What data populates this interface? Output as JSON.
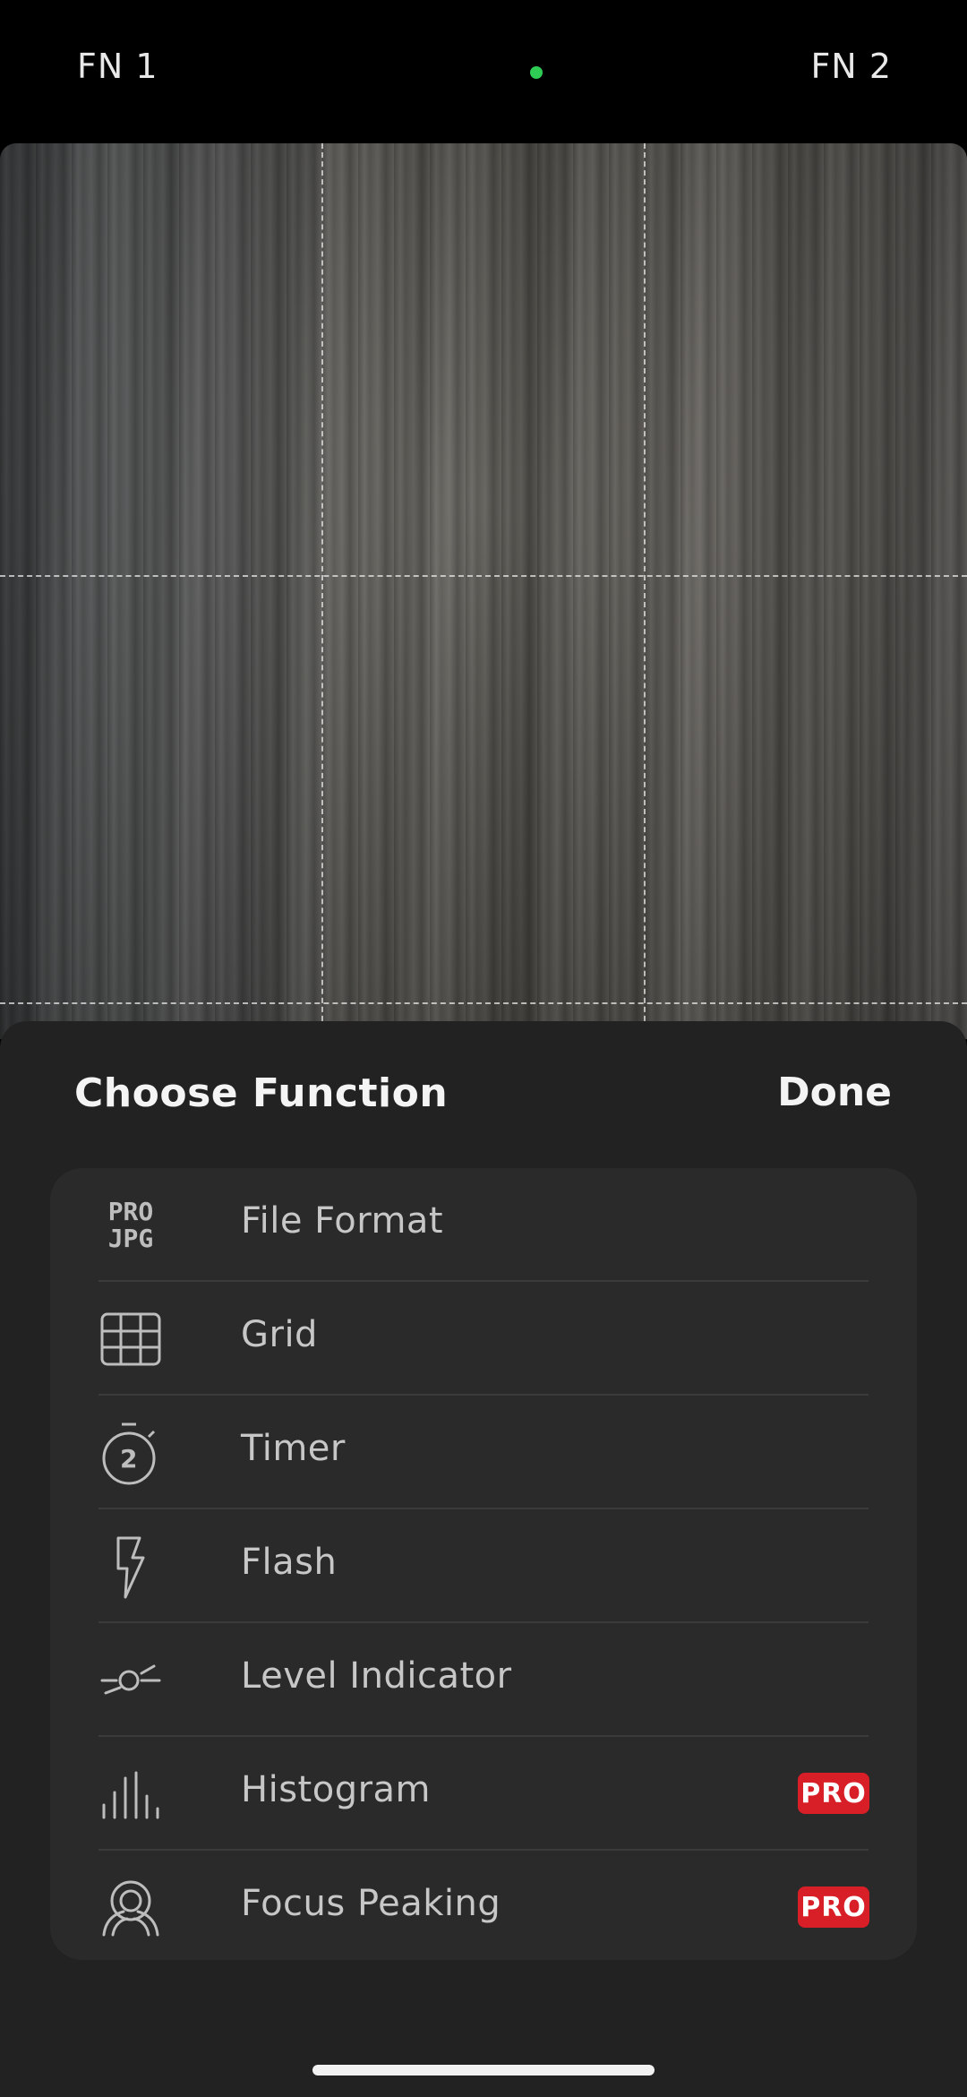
{
  "topbar": {
    "fn1": "FN 1",
    "fn2": "FN 2"
  },
  "sheet": {
    "title": "Choose Function",
    "done_label": "Done",
    "items": [
      {
        "label": "File Format",
        "icon": "file-format-icon",
        "icon_text_top": "PRO",
        "icon_text_bottom": "JPG"
      },
      {
        "label": "Grid",
        "icon": "grid-icon"
      },
      {
        "label": "Timer",
        "icon": "timer-icon",
        "icon_text": "2"
      },
      {
        "label": "Flash",
        "icon": "flash-icon"
      },
      {
        "label": "Level Indicator",
        "icon": "level-indicator-icon"
      },
      {
        "label": "Histogram",
        "icon": "histogram-icon",
        "badge": "PRO"
      },
      {
        "label": "Focus Peaking",
        "icon": "focus-peaking-icon",
        "badge": "PRO"
      }
    ]
  },
  "colors": {
    "status_dot": "#2ecc55",
    "pro_badge": "#d81e26",
    "sheet_bg": "#222222",
    "list_bg": "#2a2a2a"
  }
}
